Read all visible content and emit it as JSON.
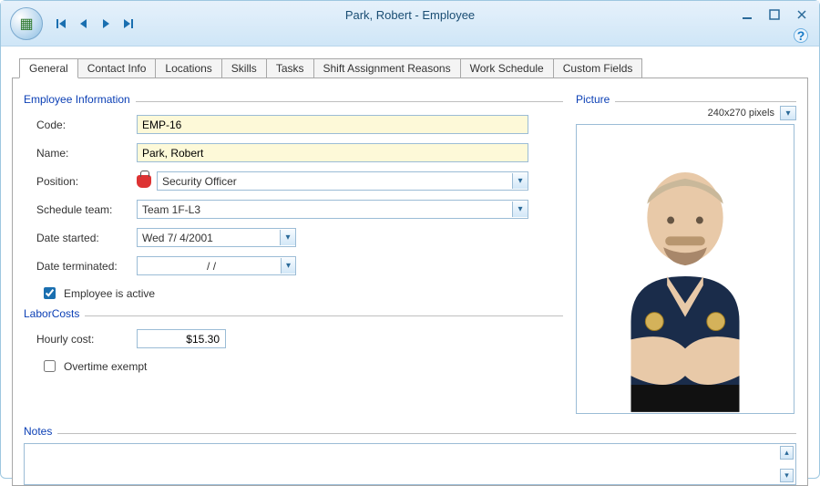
{
  "window": {
    "title": "Park, Robert - Employee"
  },
  "tabs": [
    "General",
    "Contact Info",
    "Locations",
    "Skills",
    "Tasks",
    "Shift Assignment Reasons",
    "Work Schedule",
    "Custom Fields"
  ],
  "active_tab": 0,
  "sections": {
    "employee_info": {
      "legend": "Employee Information",
      "code_label": "Code:",
      "code_value": "EMP-16",
      "name_label": "Name:",
      "name_value": "Park, Robert",
      "position_label": "Position:",
      "position_value": "Security Officer",
      "schedule_team_label": "Schedule team:",
      "schedule_team_value": "Team 1F-L3",
      "date_started_label": "Date started:",
      "date_started_value": "Wed   7/  4/2001",
      "date_terminated_label": "Date terminated:",
      "date_terminated_value": "/   /",
      "active_label": "Employee is active",
      "active_checked": true
    },
    "labor_costs": {
      "legend": "LaborCosts",
      "hourly_cost_label": "Hourly cost:",
      "hourly_cost_value": "$15.30",
      "overtime_exempt_label": "Overtime exempt",
      "overtime_exempt_checked": false
    },
    "picture": {
      "legend": "Picture",
      "size_text": "240x270 pixels"
    },
    "notes": {
      "legend": "Notes",
      "value": ""
    }
  }
}
